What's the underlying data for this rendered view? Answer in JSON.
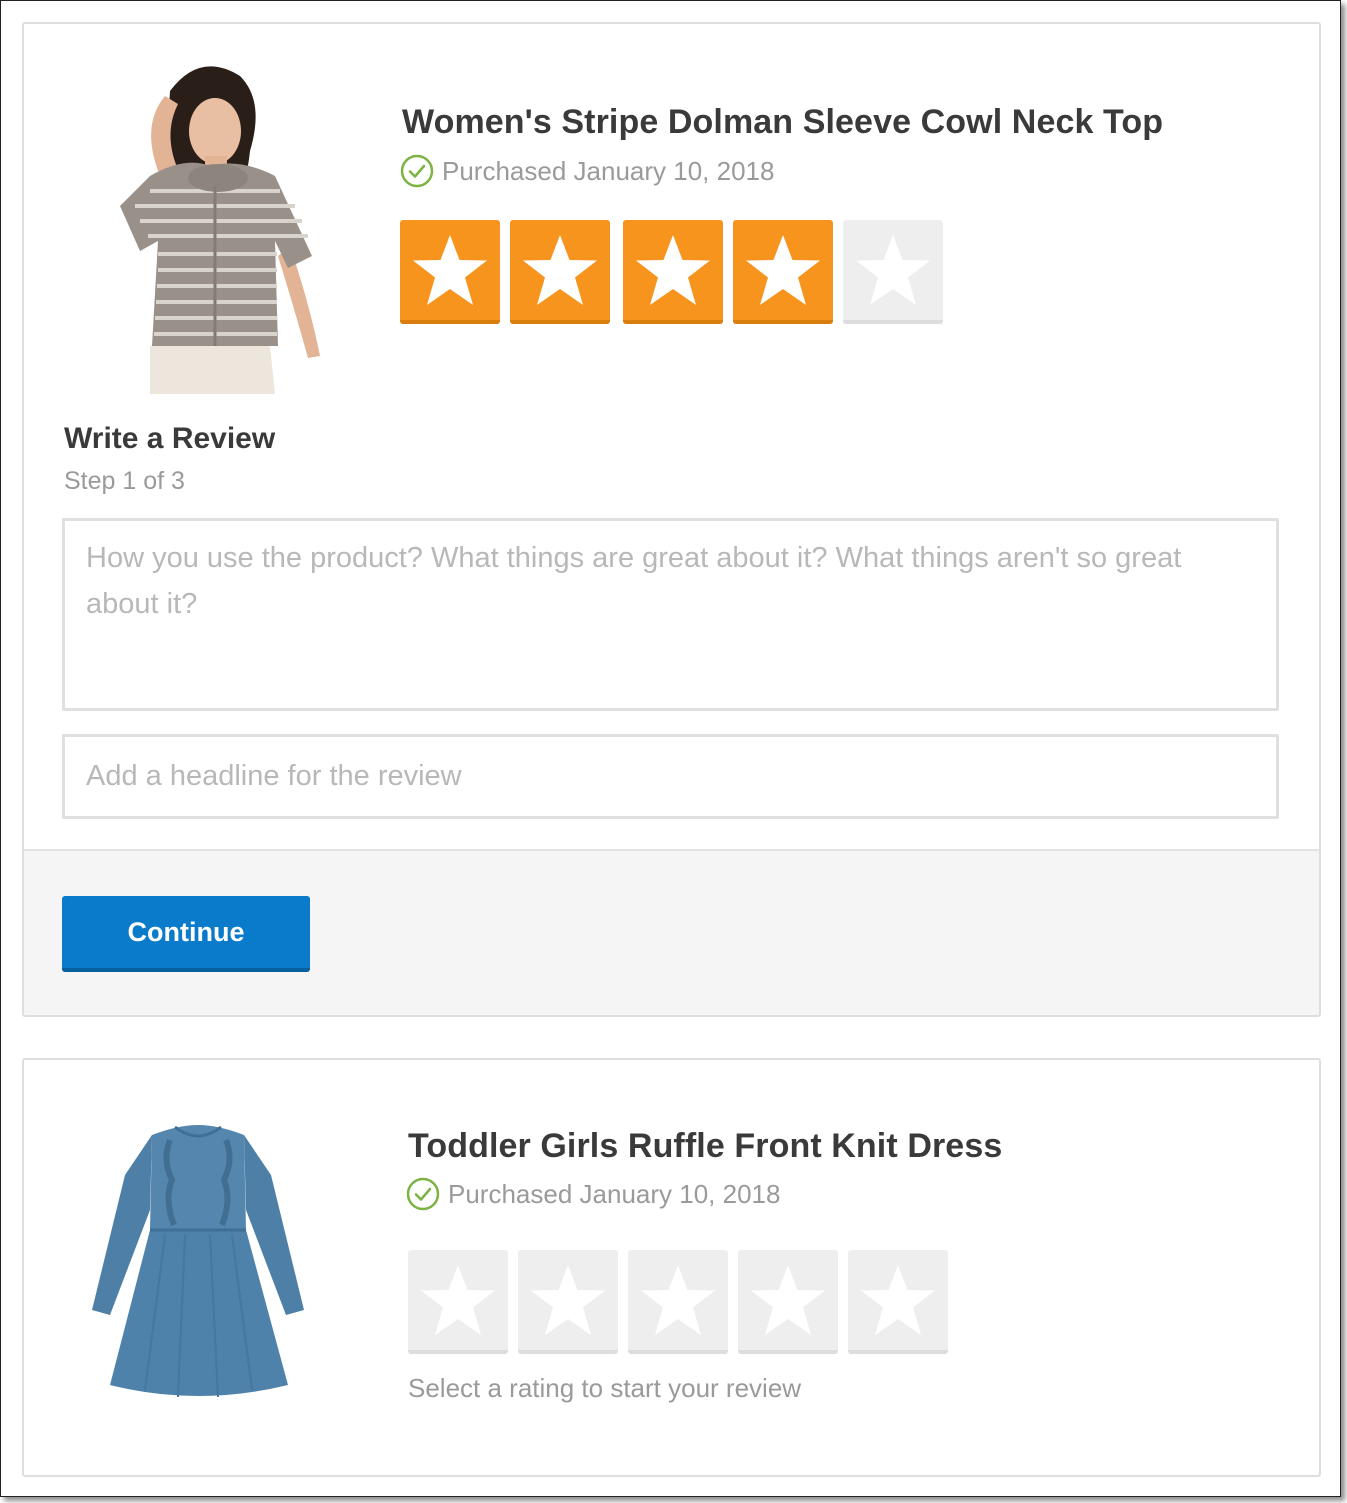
{
  "colors": {
    "star_active": "#f7941d",
    "star_inactive": "#eeeeee",
    "primary_button": "#0a7bca",
    "check_green": "#7cb342"
  },
  "products": [
    {
      "title": "Women's Stripe Dolman Sleeve Cowl Neck Top",
      "purchased": "Purchased January 10, 2018",
      "image_icon": "striped-top-photo",
      "rating": 4,
      "rating_max": 5
    },
    {
      "title": "Toddler Girls Ruffle Front Knit Dress",
      "purchased": "Purchased January 10, 2018",
      "image_icon": "blue-dress-photo",
      "rating": 0,
      "rating_max": 5,
      "hint": "Select a rating to start your review"
    }
  ],
  "review_form": {
    "title": "Write a Review",
    "step": "Step 1 of 3",
    "body_placeholder": "How you use the product? What things are great about it? What things aren't so great about it?",
    "body_value": "",
    "headline_placeholder": "Add a headline for the review",
    "headline_value": "",
    "continue_label": "Continue"
  }
}
